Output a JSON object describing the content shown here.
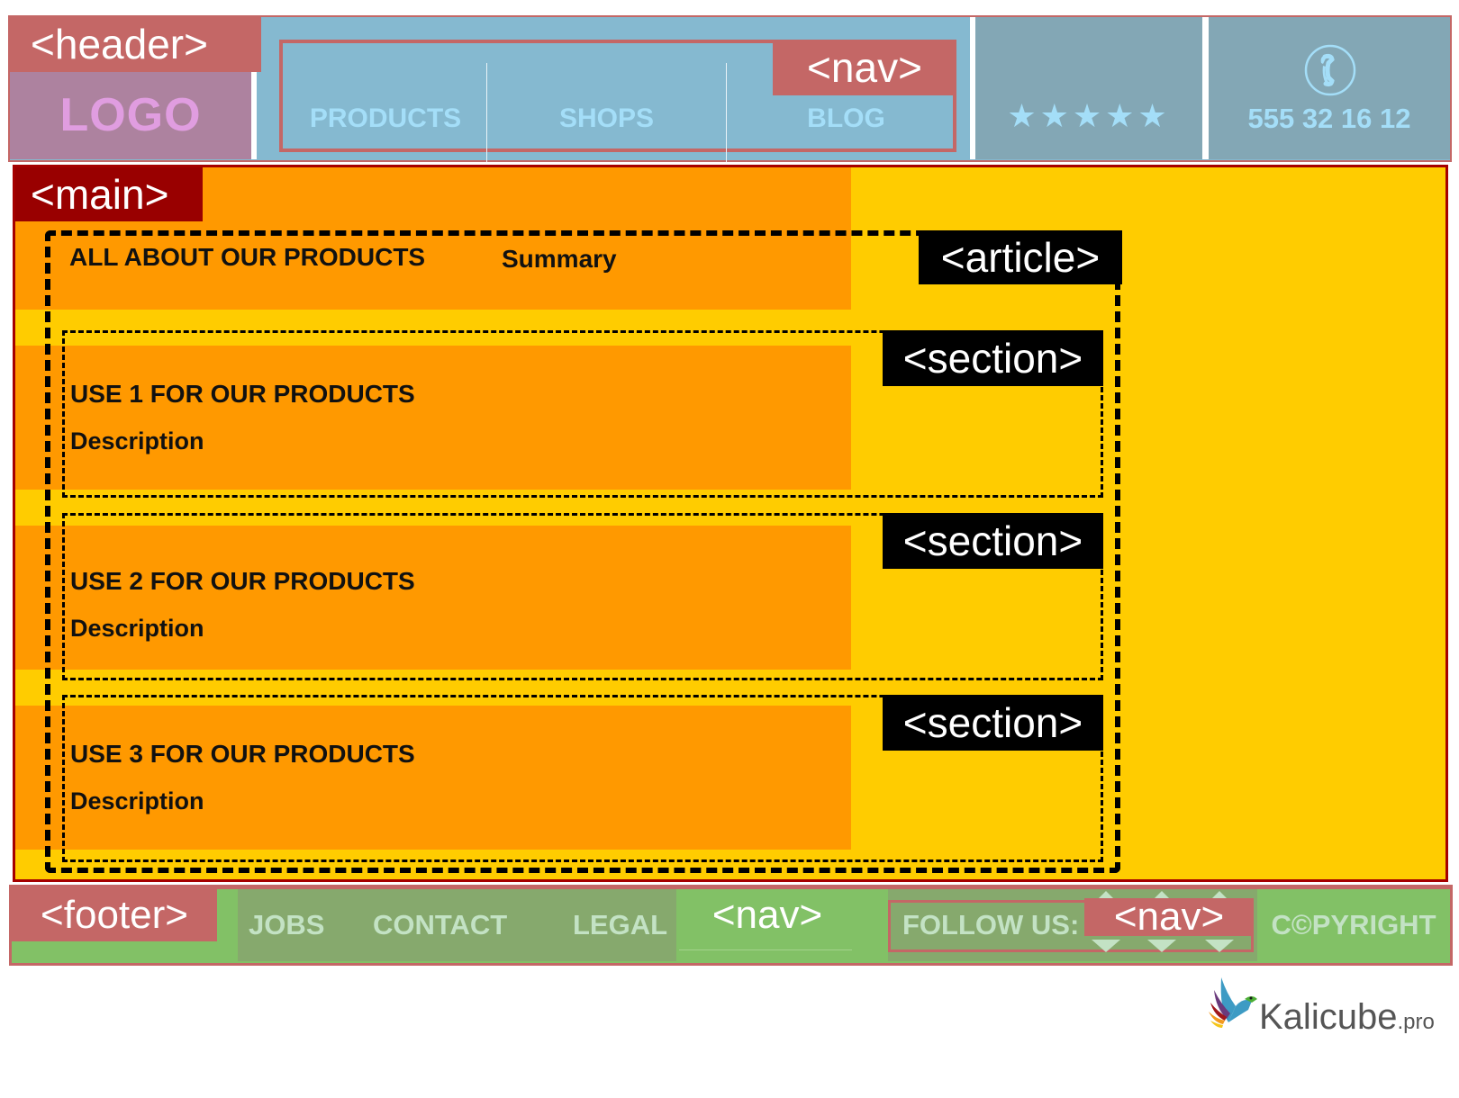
{
  "header": {
    "tag": "<header>",
    "logo": "LOGO",
    "nav": {
      "tag": "<nav>",
      "items": [
        {
          "label": "PRODUCTS"
        },
        {
          "label": "SHOPS"
        },
        {
          "label": "BLOG"
        }
      ]
    },
    "rating": {
      "stars_display": "★★★★★",
      "value": 5,
      "max": 5
    },
    "phone": {
      "icon": "phone-icon",
      "number": "555 32 16 12"
    }
  },
  "main": {
    "tag": "<main>",
    "article": {
      "tag": "<article>",
      "title": "ALL ABOUT OUR PRODUCTS",
      "summary": "Summary",
      "sections": [
        {
          "tag": "<section>",
          "title": "USE 1 FOR OUR PRODUCTS",
          "description": "Description"
        },
        {
          "tag": "<section>",
          "title": "USE 2 FOR OUR PRODUCTS",
          "description": "Description"
        },
        {
          "tag": "<section>",
          "title": "USE 3 FOR OUR PRODUCTS",
          "description": "Description"
        }
      ]
    }
  },
  "footer": {
    "tag": "<footer>",
    "links": [
      {
        "label": "JOBS"
      },
      {
        "label": "CONTACT"
      },
      {
        "label": "LEGAL"
      }
    ],
    "nav_tag": "<nav>",
    "follow": {
      "label": "FOLLOW US:",
      "nav_tag": "<nav>"
    },
    "copyright": "C©PYRIGHT"
  },
  "brand": {
    "name": "Kalicube",
    "suffix": ".pro"
  },
  "colors": {
    "header_tag": "#c46766",
    "logo_bg": "#ad829f",
    "logo_text": "#e09de0",
    "nav_bg": "#85b9d0",
    "nav_text": "#a4def8",
    "info_bg": "#83a7b5",
    "main_tag": "#990000",
    "main_bg": "#ffcc00",
    "content_bg": "#ff9900",
    "semantic_tag": "#000000",
    "footer_bg": "#82c166",
    "footer_links_bg": "#86a96d",
    "footer_text": "#c3e2c4"
  }
}
